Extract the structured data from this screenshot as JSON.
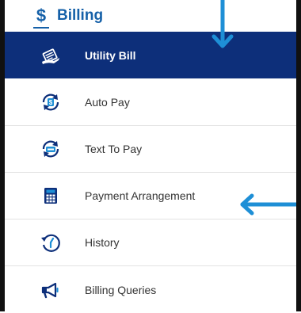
{
  "header": {
    "icon": "dollar-icon",
    "symbol": "$",
    "title": "Billing"
  },
  "menu": {
    "items": [
      {
        "label": "Utility Bill",
        "icon": "bill-icon",
        "active": true
      },
      {
        "label": "Auto Pay",
        "icon": "auto-pay-icon",
        "active": false
      },
      {
        "label": "Text To Pay",
        "icon": "text-to-pay-icon",
        "active": false
      },
      {
        "label": "Payment Arrangement",
        "icon": "calculator-icon",
        "active": false
      },
      {
        "label": "History",
        "icon": "history-icon",
        "active": false
      },
      {
        "label": "Billing Queries",
        "icon": "megaphone-icon",
        "active": false
      }
    ]
  },
  "annotations": {
    "color": "#1e8fd6",
    "arrows": [
      "down",
      "left"
    ]
  },
  "colors": {
    "accent": "#1560a8",
    "active_bg": "#0d2f7a"
  }
}
